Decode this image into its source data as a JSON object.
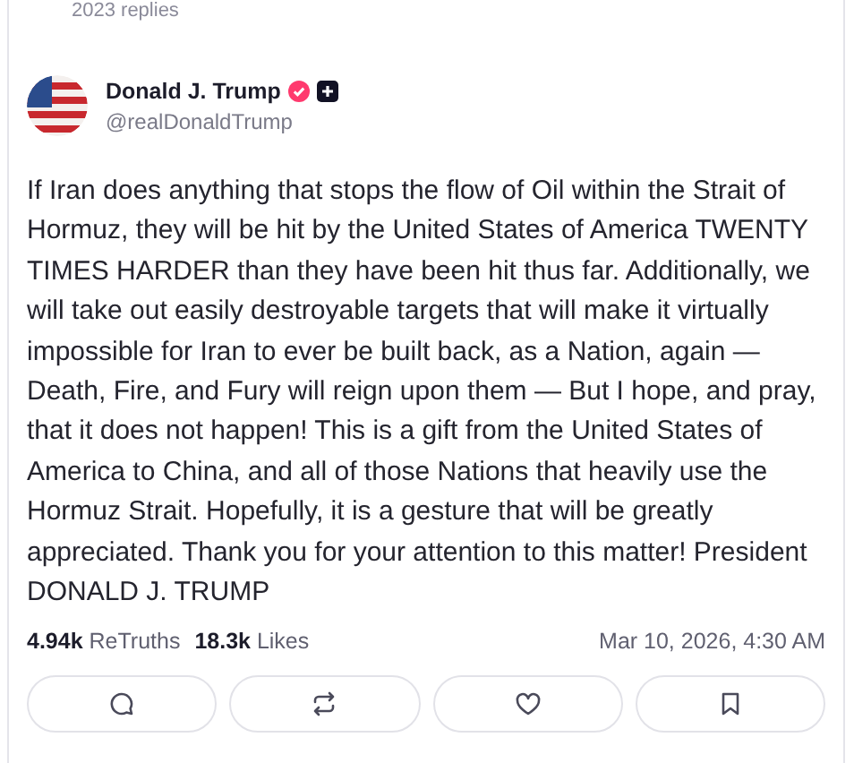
{
  "previous_post": {
    "replies": "2023 replies"
  },
  "post": {
    "author": {
      "name": "Donald J. Trump",
      "handle": "@realDonaldTrump",
      "verified": true,
      "follow_badge": true
    },
    "text": "If Iran does anything that stops the flow of Oil within the Strait of Hormuz, they will be hit by the United States of America TWENTY TIMES HARDER than they have been hit thus far. Additionally, we will take out easily destroyable targets that will make it virtually impossible for Iran to ever be built back, as a Nation, again — Death, Fire, and Fury will reign upon them — But I hope, and pray, that it does not happen! This is a gift from the United States of America to China, and all of those Nations that heavily use the Hormuz Strait. Hopefully, it is a gesture that will be greatly appreciated. Thank you for your attention to this matter! President DONALD J. TRUMP",
    "stats": [
      {
        "count": "4.94k",
        "label": "ReTruths"
      },
      {
        "count": "18.3k",
        "label": "Likes"
      }
    ],
    "timestamp": "Mar 10, 2026, 4:30 AM",
    "actions": [
      {
        "kind": "reply"
      },
      {
        "kind": "retruth"
      },
      {
        "kind": "like"
      },
      {
        "kind": "bookmark"
      }
    ]
  }
}
